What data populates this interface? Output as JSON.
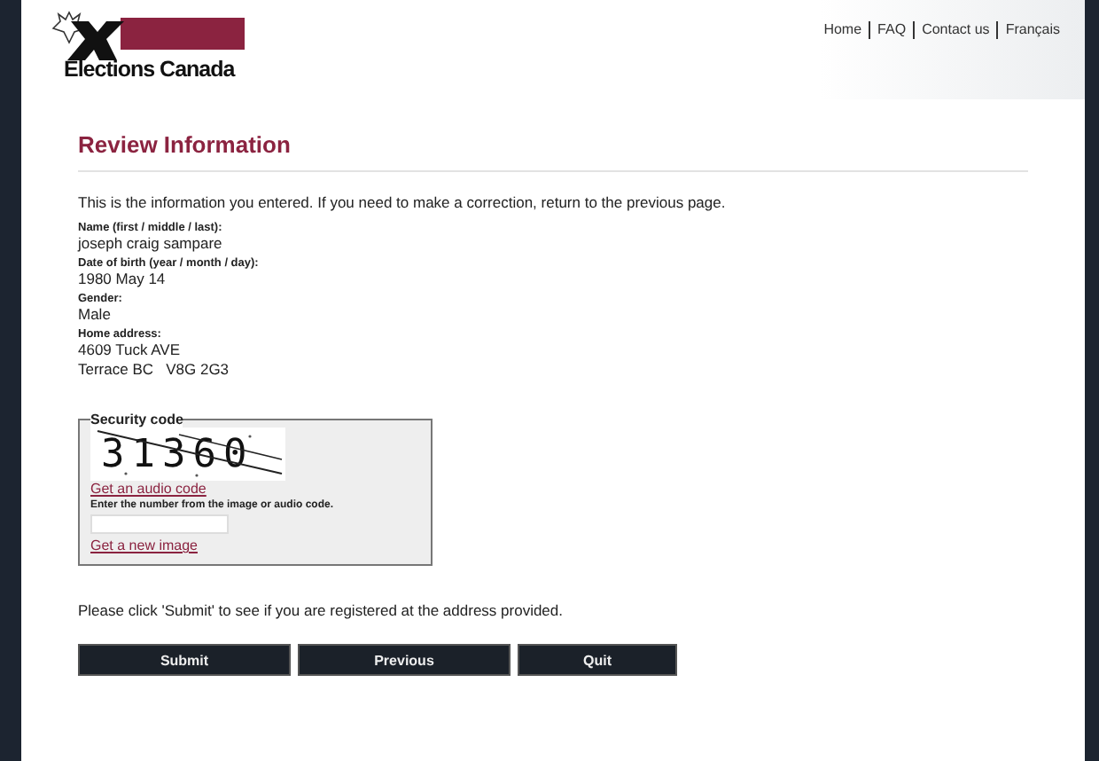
{
  "logo": {
    "text": "Elections Canada"
  },
  "top_nav": [
    "Home",
    "FAQ",
    "Contact us",
    "Français"
  ],
  "title": "Review Information",
  "intro": "This is the information you entered. If you need to make a correction, return to the previous page.",
  "fields": [
    {
      "label": "Name (first / middle / last):",
      "lines": [
        "joseph craig sampare"
      ]
    },
    {
      "label": "Date of birth (year / month / day):",
      "lines": [
        "1980 May 14"
      ]
    },
    {
      "label": "Gender:",
      "lines": [
        "Male"
      ]
    },
    {
      "label": "Home address:",
      "lines": [
        "4609 Tuck AVE",
        "Terrace BC   V8G 2G3"
      ]
    }
  ],
  "security": {
    "legend": "Security code",
    "captcha": "31360",
    "audio_link": "Get an audio code",
    "instruction": "Enter the number from the image or audio code.",
    "new_image_link": "Get a new image"
  },
  "note": "Please click 'Submit' to see if you are registered at the address provided.",
  "buttons": [
    "Submit",
    "Previous",
    "Quit"
  ]
}
